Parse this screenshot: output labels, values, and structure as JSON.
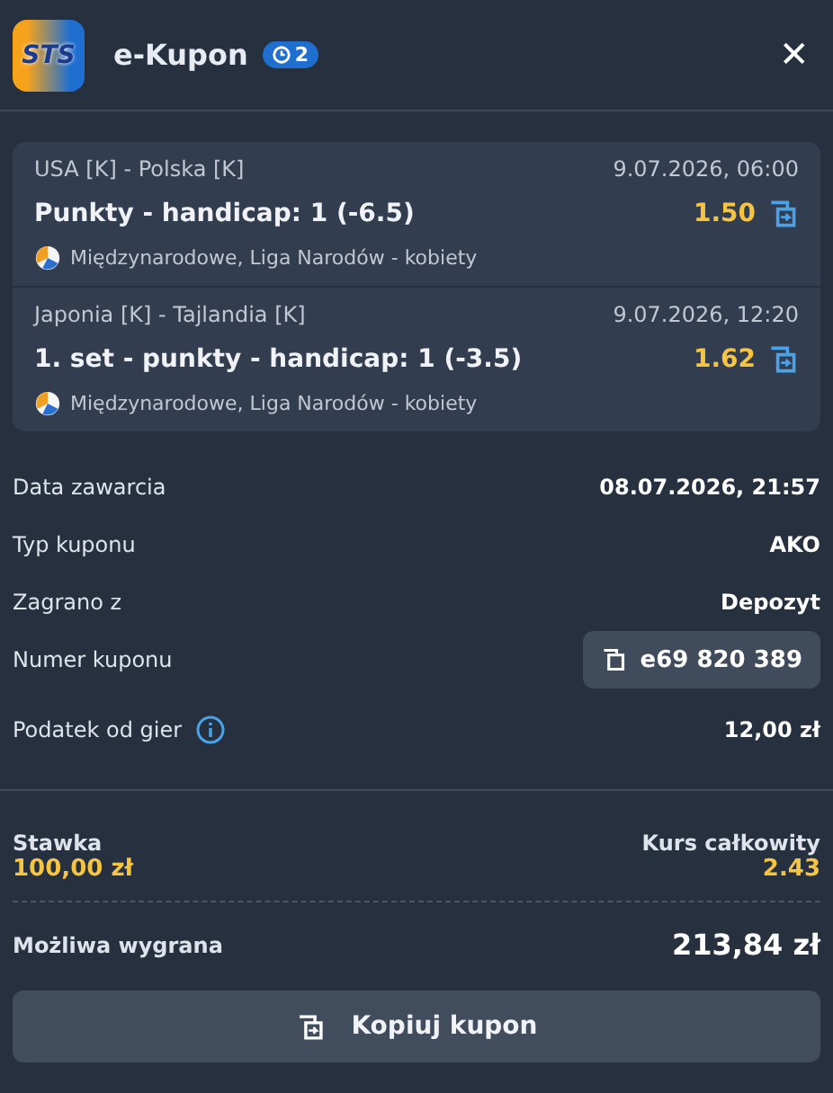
{
  "header": {
    "logo": "STS",
    "title": "e-Kupon",
    "badge": "2",
    "close": "✕"
  },
  "bets": [
    {
      "teams": "USA [K] - Polska [K]",
      "date": "9.07.2026, 06:00",
      "market": "Punkty - handicap: 1 (-6.5)",
      "odds": "1.50",
      "league": "Międzynarodowe, Liga Narodów - kobiety"
    },
    {
      "teams": "Japonia [K] - Tajlandia [K]",
      "date": "9.07.2026, 12:20",
      "market": "1. set - punkty - handicap: 1 (-3.5)",
      "odds": "1.62",
      "league": "Międzynarodowe, Liga Narodów - kobiety"
    }
  ],
  "details": [
    {
      "kind": "text",
      "label": "Data zawarcia",
      "value": "08.07.2026, 21:57"
    },
    {
      "kind": "text",
      "label": "Typ kuponu",
      "value": "AKO"
    },
    {
      "kind": "text",
      "label": "Zagrano z",
      "value": "Depozyt"
    },
    {
      "kind": "copy",
      "label": "Numer kuponu",
      "value": "e69 820 389"
    },
    {
      "kind": "info",
      "label": "Podatek od gier",
      "value": "12,00 zł"
    }
  ],
  "summary": {
    "stake_label": "Stawka",
    "stake": "100,00 zł",
    "odds_label": "Kurs całkowity",
    "odds": "2.43",
    "win_label": "Możliwa wygrana",
    "win": "213,84 zł"
  },
  "button": "Kopiuj kupon"
}
